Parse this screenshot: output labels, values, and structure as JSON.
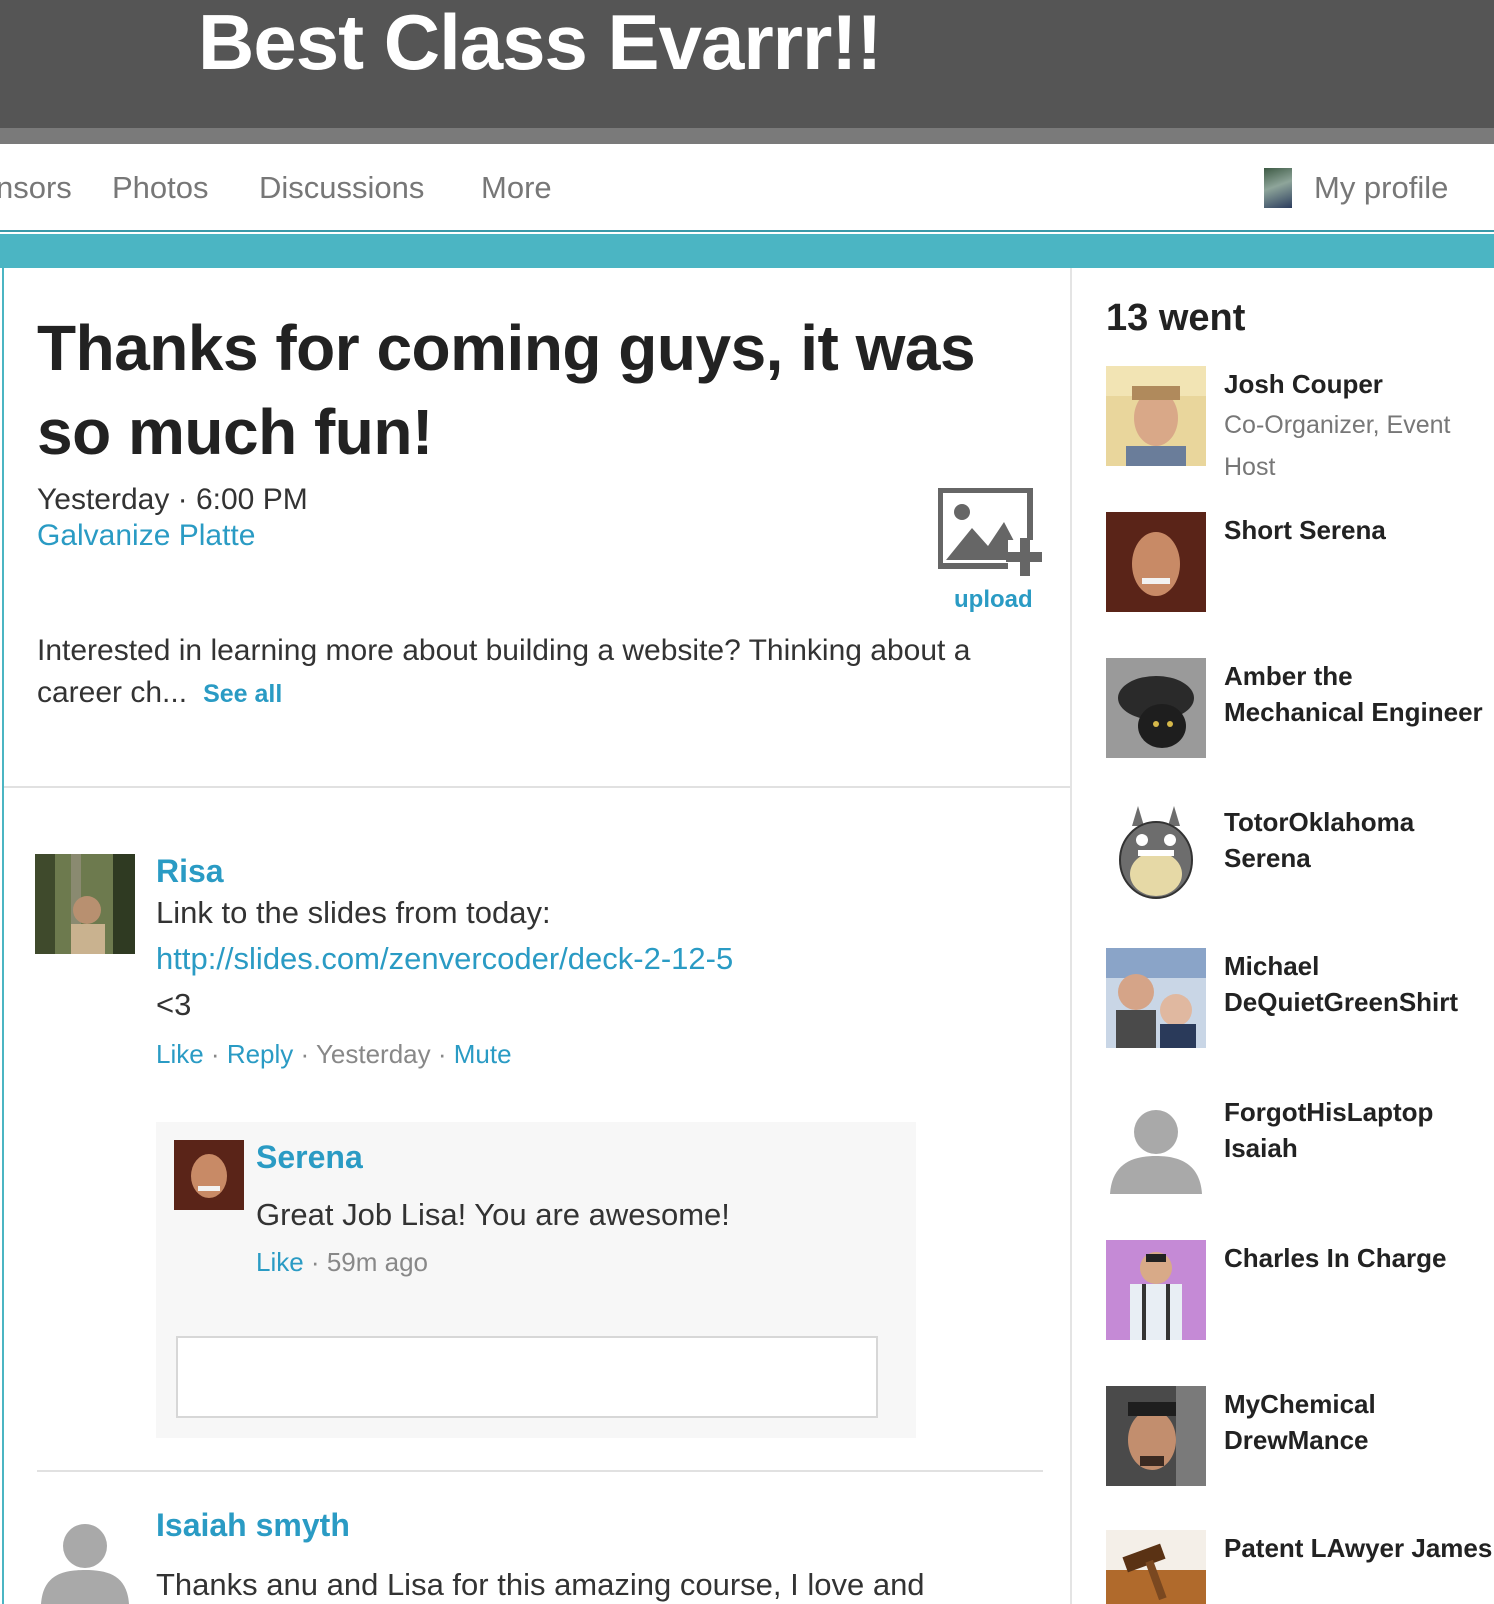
{
  "group": {
    "title": "Best Class Evarrr!!"
  },
  "nav": {
    "items": [
      "nsors",
      "Photos",
      "Discussions",
      "More"
    ],
    "profile_label": "My profile"
  },
  "event": {
    "title": "Thanks for coming guys, it was so much fun!",
    "when": "Yesterday · 6:00 PM",
    "venue": "Galvanize Platte",
    "upload_label": "upload",
    "description": "Interested in learning more about building a website? Thinking about a career ch...",
    "see_all": "See all"
  },
  "comments": [
    {
      "author": "Risa",
      "text_line1": "Link to the slides from today:",
      "link": "http://slides.com/zenvercoder/deck-2-12-5",
      "text_line3": "<3",
      "actions": {
        "like": "Like",
        "reply": "Reply",
        "time": "Yesterday",
        "mute": "Mute"
      },
      "replies": [
        {
          "author": "Serena",
          "text": "Great Job Lisa! You are awesome!",
          "actions": {
            "like": "Like",
            "time": "59m ago"
          }
        }
      ]
    },
    {
      "author": "Isaiah smyth",
      "text": "Thanks anu and Lisa for this amazing course, I love and"
    }
  ],
  "attendance": {
    "title": "13 went",
    "attendees": [
      {
        "name": "Josh Couper",
        "role": "Co-Organizer, Event Host"
      },
      {
        "name": "Short Serena",
        "role": ""
      },
      {
        "name": "Amber the Mechanical Engineer",
        "role": ""
      },
      {
        "name": "TotorOklahoma Serena",
        "role": ""
      },
      {
        "name": "Michael DeQuietGreenShirt",
        "role": ""
      },
      {
        "name": "ForgotHisLaptop Isaiah",
        "role": ""
      },
      {
        "name": "Charles In Charge",
        "role": ""
      },
      {
        "name": "MyChemical DrewMance",
        "role": ""
      },
      {
        "name": "Patent LAwyer James",
        "role": ""
      }
    ]
  },
  "colors": {
    "header": "#555555",
    "accent": "#4bb5c3",
    "link": "#2a9bc4"
  },
  "icons": [
    "image-upload-icon",
    "default-avatar-icon",
    "totoro-avatar-icon"
  ]
}
